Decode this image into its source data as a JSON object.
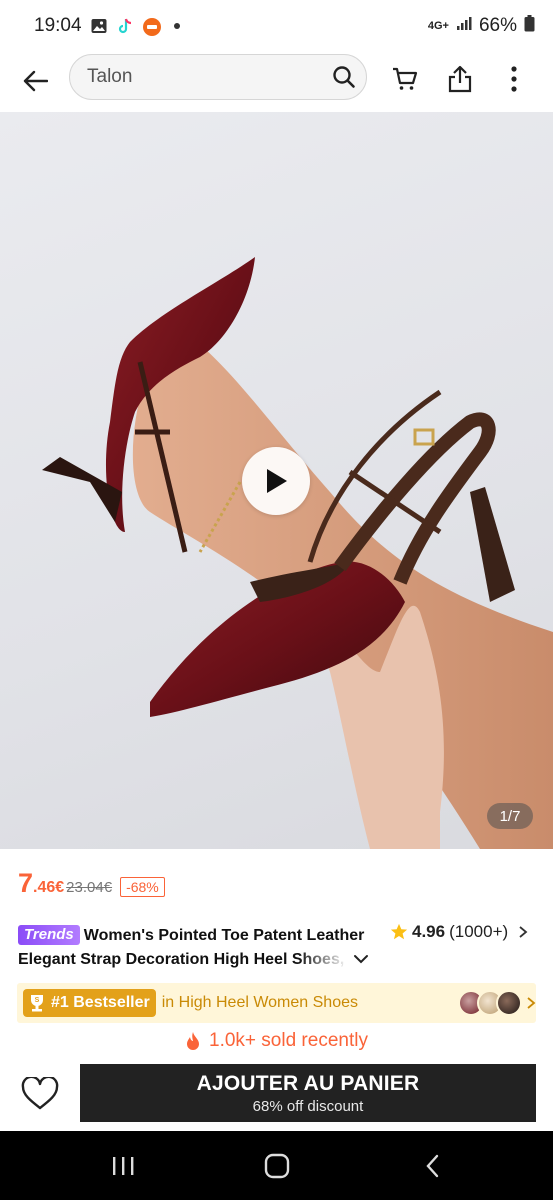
{
  "status_bar": {
    "time": "19:04",
    "network": "4G+",
    "battery": "66%"
  },
  "nav": {
    "search_value": "Talon"
  },
  "media": {
    "counter": "1/7"
  },
  "price": {
    "int": "7",
    "dec": ".46€",
    "original": "23.04€",
    "discount": "-68%"
  },
  "product": {
    "trend_badge": "Trends",
    "title_line1": "Women's Pointed Toe Patent Leather",
    "title_line2": "Elegant Strap Decoration High Heel Shoes,"
  },
  "rating": {
    "score": "4.96",
    "count": "(1000+)"
  },
  "bestseller": {
    "badge": "#1 Bestseller",
    "category": "in High Heel Women Shoes"
  },
  "sold": {
    "text": "1.0k+ sold recently"
  },
  "cart": {
    "label": "AJOUTER AU PANIER",
    "sub": "68% off discount"
  },
  "colors": {
    "accent": "#fa6338",
    "cart_bg": "#222222",
    "bestseller_bg": "#fff6d9",
    "bestseller_badge": "#e3a11a"
  }
}
